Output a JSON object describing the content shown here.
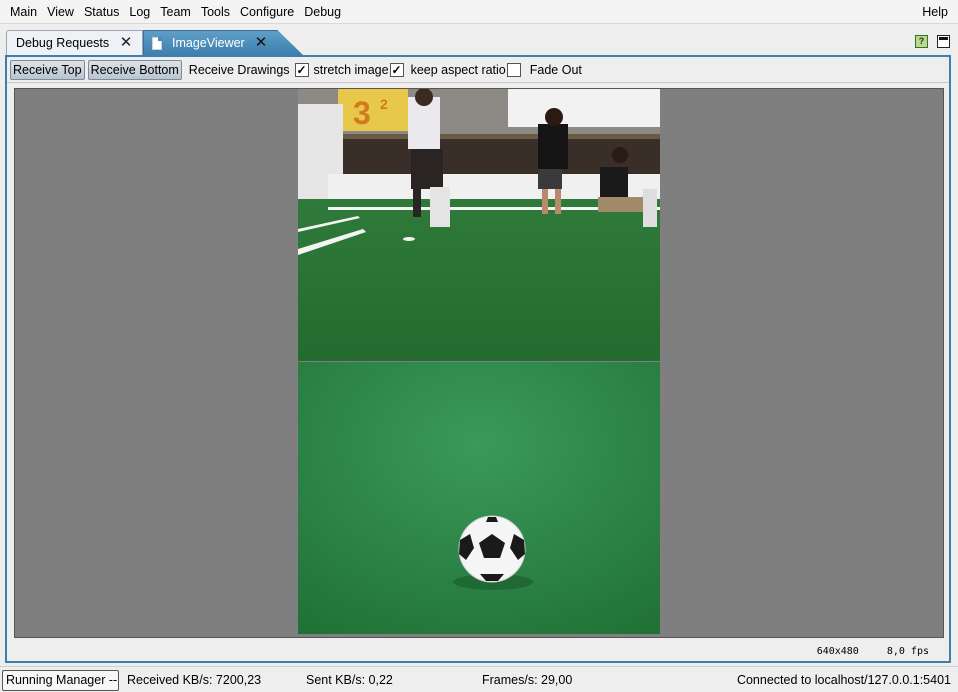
{
  "menu": {
    "items": [
      "Main",
      "View",
      "Status",
      "Log",
      "Team",
      "Tools",
      "Configure",
      "Debug"
    ],
    "help": "Help"
  },
  "tabs": {
    "debug_requests": "Debug Requests",
    "image_viewer": "ImageViewer"
  },
  "toolbar": {
    "receive_top": "Receive Top",
    "receive_bottom": "Receive Bottom",
    "receive_drawings": "Receive Drawings",
    "stretch_image": "stretch image",
    "stretch_image_checked": true,
    "keep_aspect_ratio": "keep aspect ratio",
    "keep_aspect_ratio_checked": true,
    "fade_out": "Fade Out",
    "fade_out_checked": false
  },
  "viewer": {
    "resolution": "640x480",
    "fps": "8,0 fps"
  },
  "statusbar": {
    "running_manager": "Running Manager --",
    "received": "Received KB/s: 7200,23",
    "sent": "Sent KB/s: 0,22",
    "frames": "Frames/s: 29,00",
    "connection": "Connected to localhost/127.0.0.1:5401"
  },
  "colors": {
    "accent": "#3e7fae",
    "field_green": "#2f8a3e",
    "viewer_bg": "#7f7f7f"
  }
}
